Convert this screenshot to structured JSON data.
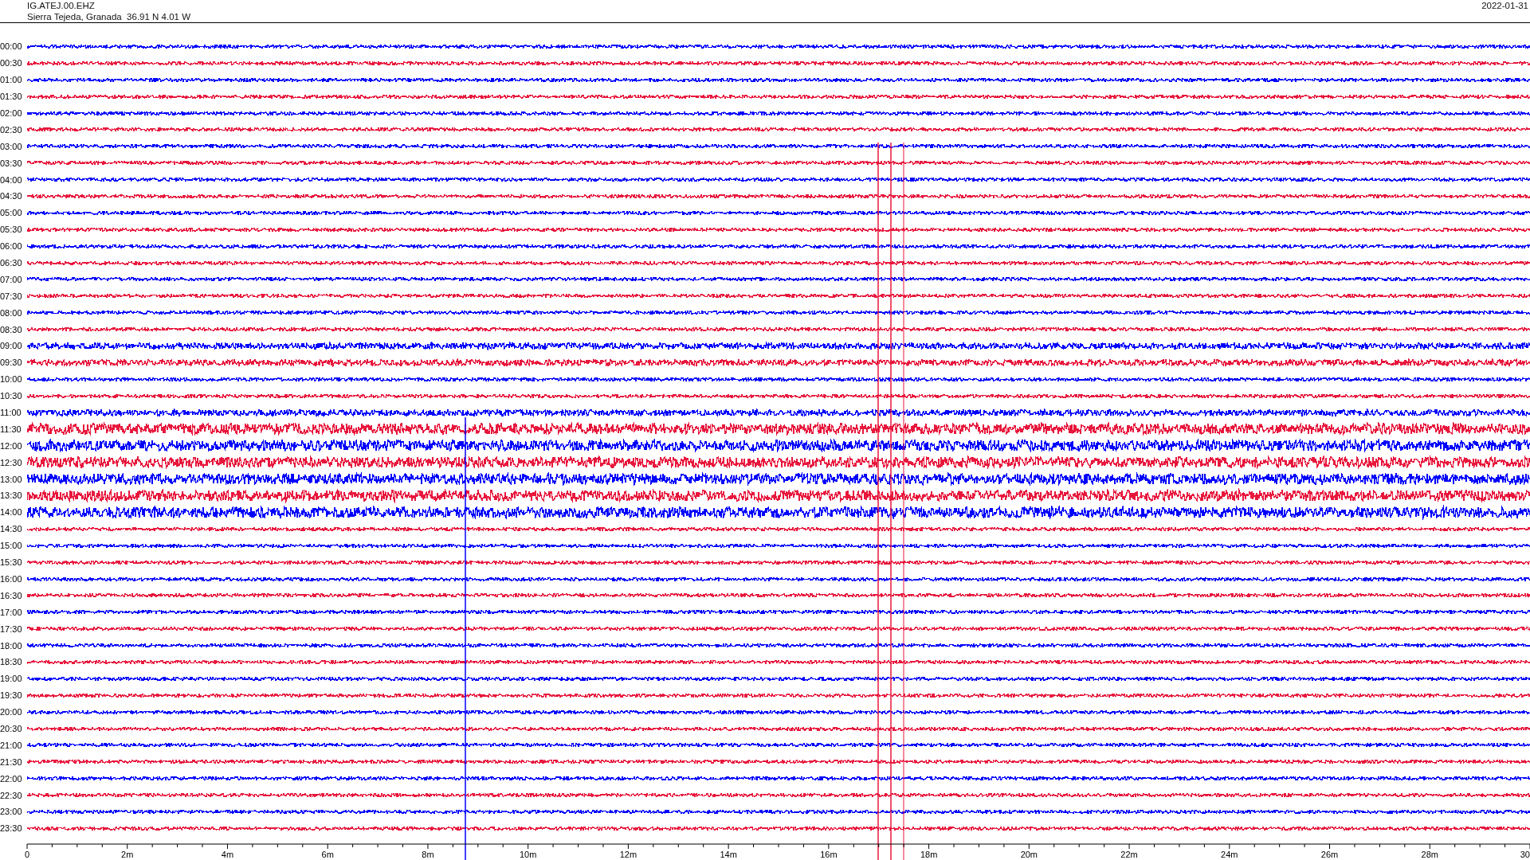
{
  "header": {
    "station": "IG.ATEJ.00.EHZ",
    "location": "Sierra Tejeda, Granada  36.91 N 4.01 W",
    "date": "2022-01-31"
  },
  "rows": [
    {
      "time": "00:00",
      "color": "#0000ff",
      "kind": "quiet"
    },
    {
      "time": "00:30",
      "color": "#e8173c",
      "kind": "quiet"
    },
    {
      "time": "01:00",
      "color": "#0000ff",
      "kind": "quiet"
    },
    {
      "time": "01:30",
      "color": "#e8173c",
      "kind": "quiet"
    },
    {
      "time": "02:00",
      "color": "#0000ff",
      "kind": "quiet"
    },
    {
      "time": "02:30",
      "color": "#e8173c",
      "kind": "quiet"
    },
    {
      "time": "03:00",
      "color": "#0000ff",
      "kind": "quiet"
    },
    {
      "time": "03:30",
      "color": "#e8173c",
      "kind": "quiet"
    },
    {
      "time": "04:00",
      "color": "#0000ff",
      "kind": "quiet"
    },
    {
      "time": "04:30",
      "color": "#e8173c",
      "kind": "quiet"
    },
    {
      "time": "05:00",
      "color": "#0000ff",
      "kind": "quiet"
    },
    {
      "time": "05:30",
      "color": "#e8173c",
      "kind": "quiet"
    },
    {
      "time": "06:00",
      "color": "#0000ff",
      "kind": "quiet"
    },
    {
      "time": "06:30",
      "color": "#e8173c",
      "kind": "quiet"
    },
    {
      "time": "07:00",
      "color": "#0000ff",
      "kind": "quiet"
    },
    {
      "time": "07:30",
      "color": "#e8173c",
      "kind": "quiet"
    },
    {
      "time": "08:00",
      "color": "#0000ff",
      "kind": "quiet"
    },
    {
      "time": "08:30",
      "color": "#e8173c",
      "kind": "quiet"
    },
    {
      "time": "09:00",
      "color": "#0000ff",
      "kind": "moderate"
    },
    {
      "time": "09:30",
      "color": "#e8173c",
      "kind": "moderate"
    },
    {
      "time": "10:00",
      "color": "#0000ff",
      "kind": "quiet"
    },
    {
      "time": "10:30",
      "color": "#e8173c",
      "kind": "quiet"
    },
    {
      "time": "11:00",
      "color": "#0000ff",
      "kind": "moderate"
    },
    {
      "time": "11:30",
      "color": "#e8173c",
      "kind": "noisy"
    },
    {
      "time": "12:00",
      "color": "#0000ff",
      "kind": "noisy"
    },
    {
      "time": "12:30",
      "color": "#e8173c",
      "kind": "noisy"
    },
    {
      "time": "13:00",
      "color": "#0000ff",
      "kind": "noisy"
    },
    {
      "time": "13:30",
      "color": "#e8173c",
      "kind": "noisy"
    },
    {
      "time": "14:00",
      "color": "#0000ff",
      "kind": "noisy"
    },
    {
      "time": "14:30",
      "color": "#e8173c",
      "kind": "quiet"
    },
    {
      "time": "15:00",
      "color": "#0000ff",
      "kind": "quiet"
    },
    {
      "time": "15:30",
      "color": "#e8173c",
      "kind": "quiet"
    },
    {
      "time": "16:00",
      "color": "#0000ff",
      "kind": "quiet"
    },
    {
      "time": "16:30",
      "color": "#e8173c",
      "kind": "quiet"
    },
    {
      "time": "17:00",
      "color": "#0000ff",
      "kind": "quiet"
    },
    {
      "time": "17:30",
      "color": "#e8173c",
      "kind": "quiet"
    },
    {
      "time": "18:00",
      "color": "#0000ff",
      "kind": "quiet"
    },
    {
      "time": "18:30",
      "color": "#e8173c",
      "kind": "quiet"
    },
    {
      "time": "19:00",
      "color": "#0000ff",
      "kind": "quiet"
    },
    {
      "time": "19:30",
      "color": "#e8173c",
      "kind": "quiet"
    },
    {
      "time": "20:00",
      "color": "#0000ff",
      "kind": "quiet"
    },
    {
      "time": "20:30",
      "color": "#e8173c",
      "kind": "quiet"
    },
    {
      "time": "21:00",
      "color": "#0000ff",
      "kind": "quiet"
    },
    {
      "time": "21:30",
      "color": "#e8173c",
      "kind": "quiet"
    },
    {
      "time": "22:00",
      "color": "#0000ff",
      "kind": "quiet"
    },
    {
      "time": "22:30",
      "color": "#e8173c",
      "kind": "quiet"
    },
    {
      "time": "23:00",
      "color": "#0000ff",
      "kind": "quiet"
    },
    {
      "time": "23:30",
      "color": "#e8173c",
      "kind": "quiet"
    }
  ],
  "x_axis": {
    "ticks": [
      "0",
      "2m",
      "4m",
      "6m",
      "8m",
      "10m",
      "12m",
      "14m",
      "16m",
      "18m",
      "20m",
      "22m",
      "24m",
      "26m",
      "28m",
      "30"
    ]
  }
}
